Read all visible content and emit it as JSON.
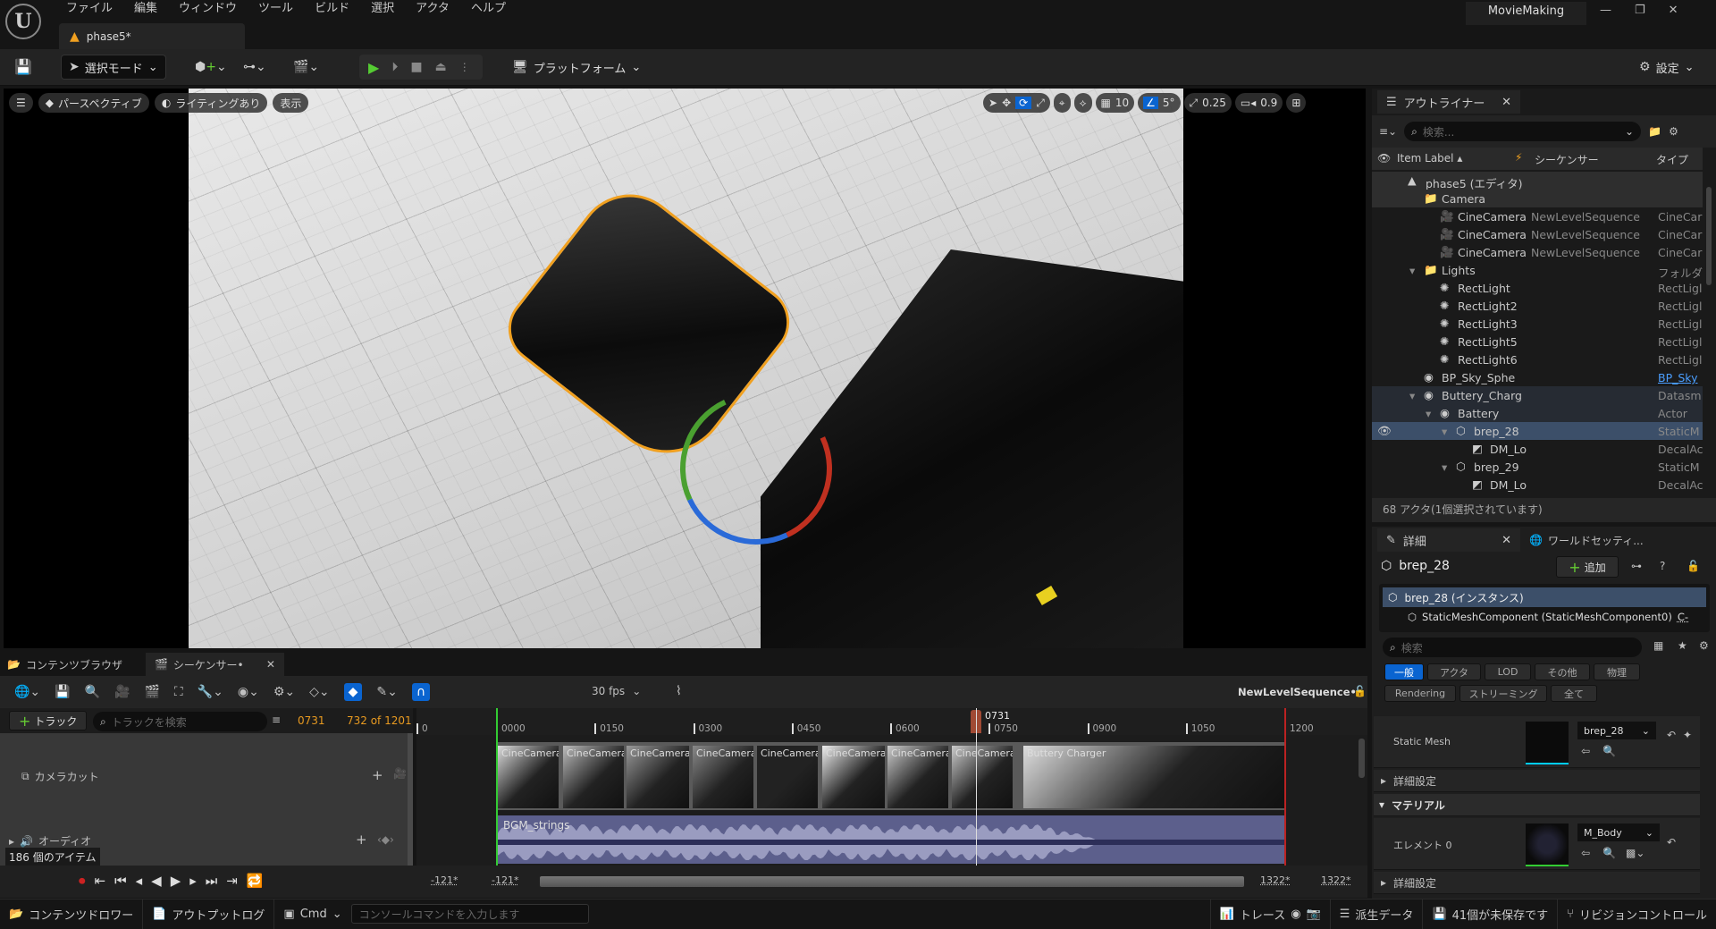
{
  "app": {
    "title": "MovieMaking",
    "document_tab": "phase5*",
    "menu": [
      "ファイル",
      "編集",
      "ウィンドウ",
      "ツール",
      "ビルド",
      "選択",
      "アクタ",
      "ヘルプ"
    ],
    "logo": "U"
  },
  "toolbar": {
    "select_mode": "選択モード",
    "platform": "プラットフォーム",
    "settings": "設定"
  },
  "viewport": {
    "perspective": "パースペクティブ",
    "lighting": "ライティングあり",
    "show": "表示",
    "grid_snap": "10",
    "angle_snap": "5°",
    "scale_snap": "0.25",
    "camera_speed": "0.9",
    "axis_x": "X",
    "axis_y": "Y",
    "active_transform": "rotate",
    "accent": "#0a64d0",
    "selection_color": "#f0a020"
  },
  "outliner": {
    "tab": "アウトライナー",
    "search_placeholder": "検索...",
    "columns": {
      "label": "Item Label",
      "sequencer": "シーケンサー",
      "type": "タイプ"
    },
    "rows": [
      {
        "label": "phase5 (エディタ)",
        "seq": "",
        "type": "",
        "depth": 0,
        "icon": "level-icon",
        "style": "hdr"
      },
      {
        "label": "Camera",
        "seq": "",
        "type": "",
        "depth": 1,
        "icon": "folder-icon",
        "style": "hdr"
      },
      {
        "label": "CineCamera",
        "seq": "NewLevelSequence",
        "type": "CineCar",
        "depth": 2,
        "icon": "camera-icon"
      },
      {
        "label": "CineCamera",
        "seq": "NewLevelSequence",
        "type": "CineCar",
        "depth": 2,
        "icon": "camera-icon"
      },
      {
        "label": "CineCamera",
        "seq": "NewLevelSequence",
        "type": "CineCar",
        "depth": 2,
        "icon": "camera-icon"
      },
      {
        "label": "Lights",
        "seq": "",
        "type": "フォルダ",
        "depth": 1,
        "icon": "folder-icon",
        "expanded": true
      },
      {
        "label": "RectLight",
        "seq": "",
        "type": "RectLigl",
        "depth": 2,
        "icon": "light-icon"
      },
      {
        "label": "RectLight2",
        "seq": "",
        "type": "RectLigl",
        "depth": 2,
        "icon": "light-icon"
      },
      {
        "label": "RectLight3",
        "seq": "",
        "type": "RectLigl",
        "depth": 2,
        "icon": "light-icon"
      },
      {
        "label": "RectLight5",
        "seq": "",
        "type": "RectLigl",
        "depth": 2,
        "icon": "light-icon"
      },
      {
        "label": "RectLight6",
        "seq": "",
        "type": "RectLigl",
        "depth": 2,
        "icon": "light-icon"
      },
      {
        "label": "BP_Sky_Sphe",
        "seq": "",
        "type": "BP_Sky",
        "depth": 1,
        "icon": "actor-icon",
        "link": true
      },
      {
        "label": "Buttery_Charg",
        "seq": "",
        "type": "Datasm",
        "depth": 1,
        "icon": "actor-icon",
        "expanded": true,
        "style": "grp"
      },
      {
        "label": "Battery",
        "seq": "",
        "type": "Actor",
        "depth": 2,
        "icon": "actor-icon",
        "expanded": true,
        "style": "grp"
      },
      {
        "label": "brep_28",
        "seq": "",
        "type": "StaticM",
        "depth": 3,
        "icon": "static-mesh-icon",
        "expanded": true,
        "style": "sel"
      },
      {
        "label": "DM_Lo",
        "seq": "",
        "type": "DecalAc",
        "depth": 4,
        "icon": "decal-icon"
      },
      {
        "label": "brep_29",
        "seq": "",
        "type": "StaticM",
        "depth": 3,
        "icon": "static-mesh-icon",
        "expanded": true
      },
      {
        "label": "DM_Lo",
        "seq": "",
        "type": "DecalAc",
        "depth": 4,
        "icon": "decal-icon"
      }
    ],
    "status": "68 アクタ(1個選択されています)"
  },
  "details": {
    "tab": "詳細",
    "world_tab": "ワールドセッティ...",
    "object": "brep_28",
    "add": "追加",
    "instance": "brep_28 (インスタンス)",
    "component": "StaticMeshComponent (StaticMeshComponent0)",
    "component_link": "C-",
    "search_placeholder": "検索",
    "filters": [
      "一般",
      "アクタ",
      "LOD",
      "その他",
      "物理",
      "Rendering",
      "ストリーミング",
      "全て"
    ],
    "active_filter": "一般",
    "static_mesh_label": "Static Mesh",
    "static_mesh_value": "brep_28",
    "advanced": "詳細設定",
    "material_section": "マテリアル",
    "element_label": "エレメント 0",
    "material_value": "M_Body"
  },
  "sequencer": {
    "tabs": [
      "コンテンツブラウザ",
      "シーケンサー•"
    ],
    "fps": "30 fps",
    "sequence_name": "NewLevelSequence•",
    "add_track": "トラック",
    "search_placeholder": "トラックを検索",
    "current_frame": "0731",
    "frame_count": "732 of 1201",
    "playhead_label": "0731",
    "ticks": [
      "0",
      "0000",
      "0150",
      "0300",
      "0450",
      "0600",
      "0750",
      "0900",
      "1050",
      "1200"
    ],
    "tracks": {
      "camera_cut": "カメラカット",
      "audio": "オーディオ"
    },
    "item_count": "186 個のアイテム",
    "shots": [
      {
        "label": "CineCamera"
      },
      {
        "label": "CineCameraA"
      },
      {
        "label": "CineCameraA"
      },
      {
        "label": "CineCamera"
      },
      {
        "label": "CineCameraA"
      },
      {
        "label": "CineCameraA"
      },
      {
        "label": "CineCameraA"
      },
      {
        "label": "CineCameraA"
      },
      {
        "label": "Buttery Charger"
      }
    ],
    "audio_clip": "BGM_strings",
    "range_start": "-121*",
    "range_start2": "-121*",
    "range_end": "1322*",
    "range_end2": "1322*"
  },
  "statusbar": {
    "content_drawer": "コンテンツドロワー",
    "output_log": "アウトプットログ",
    "cmd": "Cmd",
    "console_placeholder": "コンソールコマンドを入力します",
    "trace": "トレース",
    "derived_data": "派生データ",
    "unsaved": "41個が未保存です",
    "revision_control": "リビジョンコントロール"
  }
}
